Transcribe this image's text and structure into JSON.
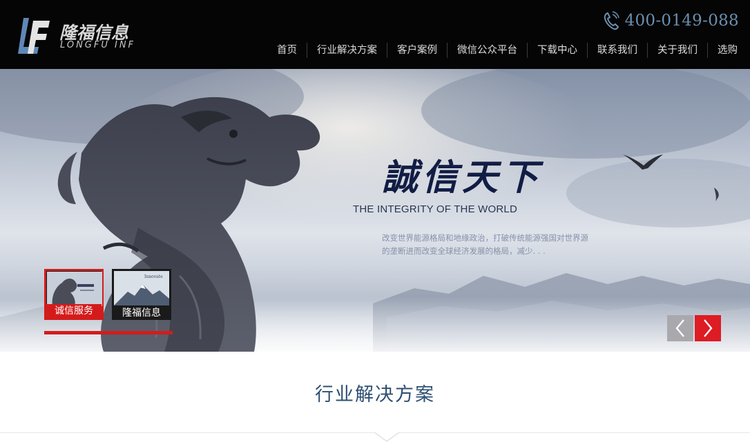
{
  "header": {
    "logo_cn": "隆福信息",
    "logo_en": "LONGFU INF",
    "phone": "400-0149-088",
    "nav": [
      "首页",
      "行业解决方案",
      "客户案例",
      "微信公众平台",
      "下载中心",
      "联系我们",
      "关于我们",
      "选购"
    ]
  },
  "banner": {
    "headline_cn": "誠信天下",
    "headline_en": "THE INTEGRITY OF THE WORLD",
    "desc": "改变世界能源格局和地缘政治，打破传统能源强国对世界源的垄断进而改变全球经济发展的格局，减少. . .",
    "thumbs": [
      "诚信服务",
      "隆福信息"
    ],
    "thumb2_caption": "Innovate"
  },
  "section": {
    "title": "行业解决方案"
  },
  "colors": {
    "header_bg": "#050505",
    "accent_red": "#d41b1b",
    "phone_blue": "#6b8fb0",
    "title_blue": "#2d4f72"
  },
  "icons": {
    "phone": "phone-icon",
    "prev": "chevron-left-icon",
    "next": "chevron-right-icon"
  }
}
